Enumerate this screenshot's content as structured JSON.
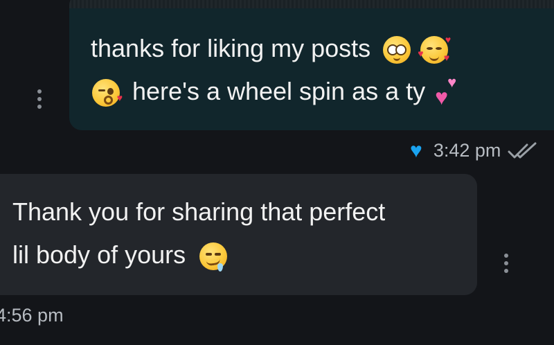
{
  "chat": {
    "outgoing": {
      "line1": "thanks for liking my posts",
      "line2": "here's a wheel spin as a ty",
      "emojis": [
        "pleading-face-emoji",
        "smiling-face-with-hearts-emoji",
        "face-blowing-kiss-emoji",
        "two-hearts-emoji"
      ],
      "reaction": "blue-heart",
      "time": "3:42 pm",
      "status": "read-double-check"
    },
    "incoming": {
      "line1": "Thank you for sharing that perfect",
      "line2": "lil body of yours",
      "emojis": [
        "drooling-face-emoji"
      ],
      "time": "4:56 pm"
    }
  },
  "colors": {
    "background": "#131519",
    "outgoing_bubble": "#11262c",
    "incoming_bubble": "#23262b",
    "reaction_heart": "#1aa3f0",
    "meta_text": "#b7bcc2"
  }
}
